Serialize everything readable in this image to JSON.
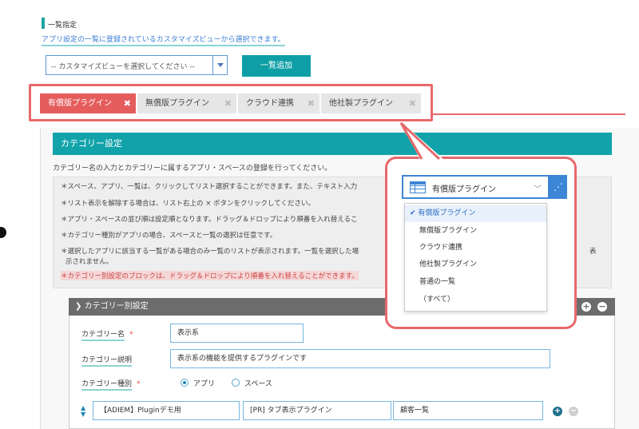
{
  "section": {
    "title": "一覧指定",
    "description": "アプリ設定の一覧に登録されているカスタマイズビューから選択できます。"
  },
  "view_select": {
    "value": "-- カスタマイズビューを選択してください --"
  },
  "add_button": "一覧追加",
  "tabs": [
    {
      "label": "有償版プラグイン",
      "active": true
    },
    {
      "label": "無償版プラグイン",
      "active": false
    },
    {
      "label": "クラウド連携",
      "active": false
    },
    {
      "label": "他社製プラグイン",
      "active": false
    }
  ],
  "tab_close_glyph": "✖",
  "category_settings": {
    "header": "カテゴリー設定",
    "description": "カテゴリー名の入力とカテゴリーに属するアプリ・スペースの登録を行ってください。",
    "notes": [
      "＊スペース、アプリ、一覧は、クリックしてリスト選択することができます。また、テキスト入力",
      "＊リスト表示を解除する場合は、リスト右上の × ボタンをクリックしてください。",
      "＊アプリ・スペースの並び順は設定順となります。ドラッグ＆ドロップにより順番を入れ替えるこ",
      "＊カテゴリー種別がアプリの場合、スペースと一覧の選択は任意です。",
      "＊選択したアプリに該当する一覧がある場合のみ一覧のリストが表示されます。一覧を選択した場",
      "示されません。",
      "＊カテゴリー別設定のブロックは、ドラッグ＆ドロップにより順番を入れ替えることができます。"
    ],
    "notes_overflow_text": "表"
  },
  "category_block": {
    "header": "カテゴリー別設定",
    "name_label": "カテゴリー名",
    "name_value": "表示系",
    "desc_label": "カテゴリー説明",
    "desc_value": "表示系の機能を提供するプラグインです",
    "type_label": "カテゴリー種別",
    "required_mark": "*",
    "type_options": [
      "アプリ",
      "スペース"
    ],
    "type_selected": "アプリ",
    "row": {
      "app": "【ADIEM】Pluginデモ用",
      "space": "[PR] タブ表示プラグイン",
      "view": "顧客一覧"
    }
  },
  "dropdown": {
    "selected_label": "有償版プラグイン",
    "items": [
      {
        "label": "有償版プラグイン",
        "selected": true,
        "check": "✔"
      },
      {
        "label": "無償版プラグイン",
        "selected": false
      },
      {
        "label": "クラウド連携",
        "selected": false
      },
      {
        "label": "他社製プラグイン",
        "selected": false
      },
      {
        "label": "普通の一覧",
        "selected": false
      },
      {
        "label": "（すべて）",
        "selected": false
      }
    ]
  },
  "colors": {
    "accent_teal": "#12a3aa",
    "tab_active": "#e55c5c",
    "highlight_red": "#e8686b",
    "select_blue": "#3d86d6"
  },
  "icons": [
    "chevron-down-icon",
    "close-icon",
    "plus-circle-icon",
    "minus-circle-icon",
    "grid-icon",
    "share-icon",
    "sort-icon",
    "check-icon"
  ]
}
